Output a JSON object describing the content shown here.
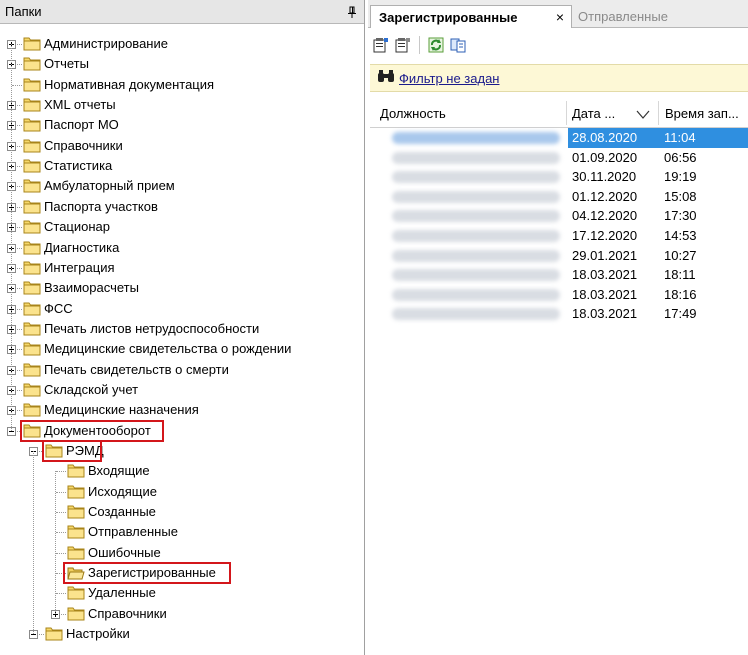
{
  "left_panel": {
    "title": "Папки",
    "pin_icon": "pin-icon"
  },
  "tree": [
    {
      "label": "Администрирование",
      "level": 0,
      "expander": "plus"
    },
    {
      "label": "Отчеты",
      "level": 0,
      "expander": "plus"
    },
    {
      "label": "Нормативная документация",
      "level": 0,
      "expander": "none"
    },
    {
      "label": "XML отчеты",
      "level": 0,
      "expander": "plus"
    },
    {
      "label": "Паспорт МО",
      "level": 0,
      "expander": "plus"
    },
    {
      "label": "Справочники",
      "level": 0,
      "expander": "plus"
    },
    {
      "label": "Статистика",
      "level": 0,
      "expander": "plus"
    },
    {
      "label": "Амбулаторный прием",
      "level": 0,
      "expander": "plus"
    },
    {
      "label": "Паспорта участков",
      "level": 0,
      "expander": "plus"
    },
    {
      "label": "Стационар",
      "level": 0,
      "expander": "plus"
    },
    {
      "label": "Диагностика",
      "level": 0,
      "expander": "plus"
    },
    {
      "label": "Интеграция",
      "level": 0,
      "expander": "plus"
    },
    {
      "label": "Взаиморасчеты",
      "level": 0,
      "expander": "plus"
    },
    {
      "label": "ФСС",
      "level": 0,
      "expander": "plus"
    },
    {
      "label": "Печать листов нетрудоспособности",
      "level": 0,
      "expander": "plus"
    },
    {
      "label": "Медицинские свидетельства о рождении",
      "level": 0,
      "expander": "plus"
    },
    {
      "label": "Печать свидетельств о смерти",
      "level": 0,
      "expander": "plus"
    },
    {
      "label": "Складской учет",
      "level": 0,
      "expander": "plus"
    },
    {
      "label": "Медицинские назначения",
      "level": 0,
      "expander": "plus"
    },
    {
      "label": "Документооборот",
      "level": 0,
      "expander": "minus",
      "highlight": true
    },
    {
      "label": "РЭМД",
      "level": 1,
      "expander": "minus",
      "highlight": true
    },
    {
      "label": "Входящие",
      "level": 2,
      "expander": "none"
    },
    {
      "label": "Исходящие",
      "level": 2,
      "expander": "none"
    },
    {
      "label": "Созданные",
      "level": 2,
      "expander": "none"
    },
    {
      "label": "Отправленные",
      "level": 2,
      "expander": "none"
    },
    {
      "label": "Ошибочные",
      "level": 2,
      "expander": "none"
    },
    {
      "label": "Зарегистрированные",
      "level": 2,
      "expander": "none",
      "highlight": true,
      "open": true
    },
    {
      "label": "Удаленные",
      "level": 2,
      "expander": "none"
    },
    {
      "label": "Справочники",
      "level": 2,
      "expander": "plus"
    },
    {
      "label": "Настройки",
      "level": 1,
      "expander": "minus"
    }
  ],
  "tabs": [
    {
      "label": "Зарегистрированные",
      "active": true,
      "close": "×"
    },
    {
      "label": "Отправленные",
      "active": false
    }
  ],
  "toolbar": {
    "icons": [
      "properties-icon",
      "properties-alt-icon",
      "refresh-icon",
      "export-icon"
    ]
  },
  "filter": {
    "icon": "binoculars-icon",
    "label": "Фильтр не задан"
  },
  "grid": {
    "columns": [
      "Должность",
      "Дата ...",
      "Время зап..."
    ],
    "sort_icon": "sort-desc-icon",
    "rows": [
      {
        "date": "28.08.2020",
        "time": "11:04",
        "selected": true
      },
      {
        "date": "01.09.2020",
        "time": "06:56"
      },
      {
        "date": "30.11.2020",
        "time": "19:19"
      },
      {
        "date": "01.12.2020",
        "time": "15:08"
      },
      {
        "date": "04.12.2020",
        "time": "17:30"
      },
      {
        "date": "17.12.2020",
        "time": "14:53"
      },
      {
        "date": "29.01.2021",
        "time": "10:27"
      },
      {
        "date": "18.03.2021",
        "time": "18:11"
      },
      {
        "date": "18.03.2021",
        "time": "18:16"
      },
      {
        "date": "18.03.2021",
        "time": "17:49"
      }
    ]
  },
  "colors": {
    "highlight_border": "#d3161b",
    "selection": "#2f8fe0",
    "filter_bg": "#fdf8d6",
    "folder": "#f5d76e"
  }
}
